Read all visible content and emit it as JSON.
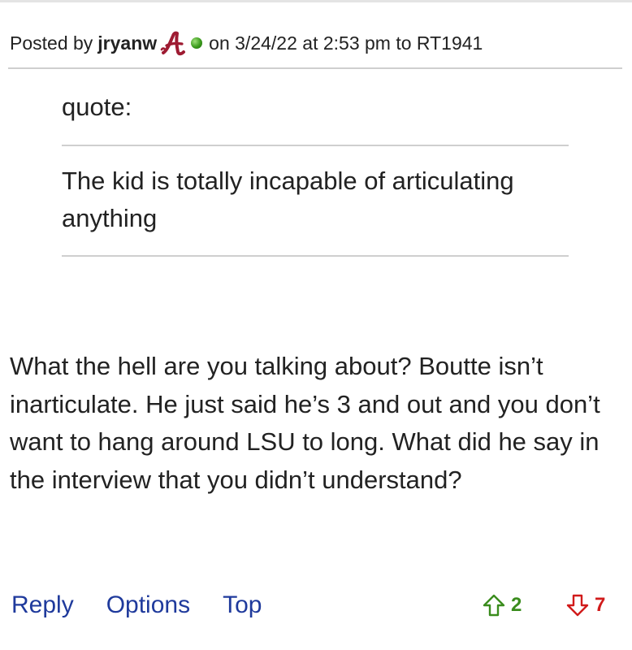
{
  "post": {
    "posted_by_prefix": "Posted by",
    "username": "jryanw",
    "team_logo": "alabama-script-a-icon",
    "online_status": "online-dot-icon",
    "meta": "on 3/24/22 at 2:53 pm to RT1941"
  },
  "quote": {
    "label": "quote:",
    "text": "The kid is totally incapable of articulating anything"
  },
  "body": {
    "text": "What the hell are you talking about? Boutte isn’t inarticulate. He just said he’s 3 and out and you don’t want to hang around LSU to long. What did he say in the interview that you didn’t understand?"
  },
  "actions": {
    "reply": "Reply",
    "options": "Options",
    "top": "Top"
  },
  "votes": {
    "up_count": "2",
    "down_count": "7",
    "up_color": "#3a8c1d",
    "down_color": "#d11b1b"
  },
  "colors": {
    "link": "#1f3a9c",
    "team_logo": "#9e1b32"
  }
}
